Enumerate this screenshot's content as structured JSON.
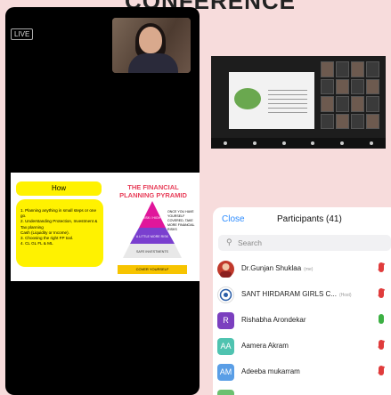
{
  "page": {
    "heading": "CONFERENCE"
  },
  "video": {
    "live_label": "LIVE",
    "slide": {
      "how_label": "How",
      "steps": [
        "1. Planning anything in small steps or one go.",
        "2. Understanding Protection, Investment & Tax planning",
        "Cash (Liquidity or Income).",
        "3. Choosing the right FP tool.",
        "4. CL GL FL & ML"
      ],
      "title": "THE FINANCIAL PLANNING PYRAMID",
      "pyramid": {
        "top": "HIGHER RISK / HIGH REWARD",
        "middle": "A LITTLE MORE RISK",
        "lower": "SAFE INVESTMENTS",
        "base": "COVER YOURSELF"
      },
      "note": "ONCE YOU HAVE YOURSELF COVERED, TAKE MORE FINANCIAL RISKS"
    }
  },
  "participants": {
    "close_label": "Close",
    "title": "Participants (41)",
    "search_placeholder": "Search",
    "list": [
      {
        "name": "Dr.Gunjan Shuklaa",
        "tag": "(me)",
        "initials": "",
        "avatar_color": "#c0392b",
        "mic": "muted"
      },
      {
        "name": "SANT HIRDARAM GIRLS C...",
        "tag": "(Host)",
        "initials": "",
        "avatar_color": "#ffffff",
        "mic": "muted"
      },
      {
        "name": "Rishabha Arondekar",
        "tag": "",
        "initials": "R",
        "avatar_color": "#7b3fbf",
        "mic": "on"
      },
      {
        "name": "Aamera Akram",
        "tag": "",
        "initials": "AA",
        "avatar_color": "#4fc3b0",
        "mic": "muted"
      },
      {
        "name": "Adeeba mukarram",
        "tag": "",
        "initials": "AM",
        "avatar_color": "#5a9ee6",
        "mic": "muted"
      }
    ]
  }
}
